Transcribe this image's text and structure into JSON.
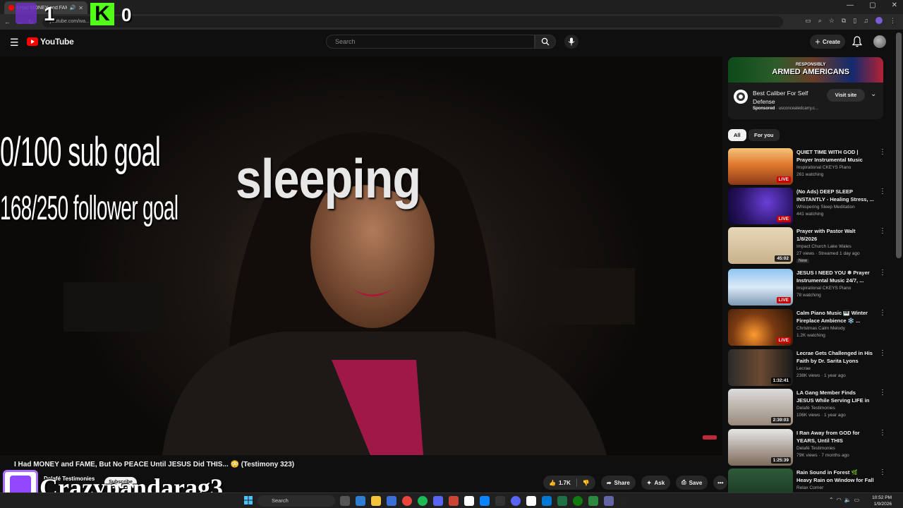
{
  "browser": {
    "tab_title": "I Had MONEY and FAME, B",
    "url": "youtube.com/wa... bey-rbJkto"
  },
  "stream_overlay": {
    "counter_left": "1",
    "counter_right": "0",
    "kick_letter": "K",
    "sub_goal": "0/100 sub goal",
    "follower_goal": "168/250 follower goal",
    "status": "sleeping",
    "streamer_name": "Crazypandarag3"
  },
  "header": {
    "logo_text": "YouTube",
    "search_placeholder": "Search",
    "create_label": "Create"
  },
  "video": {
    "title": "I Had MONEY and FAME, But No PEACE Until JESUS Did THIS... 😳 (Testimony 323)",
    "channel": "Delafé Testimonies",
    "subscribe_label": "Subscribe",
    "likes": "1.7K",
    "share_label": "Share",
    "ask_label": "Ask",
    "save_label": "Save"
  },
  "ad": {
    "banner_text": "ARMED AMERICANS",
    "banner_top": "RESPONSIBLY",
    "title": "Best Caliber For Self Defense",
    "sponsored": "Sponsored",
    "domain": "usconcealedcarry.c...",
    "visit_label": "Visit site"
  },
  "chips": [
    "All",
    "For you"
  ],
  "recommendations": [
    {
      "title": "QUIET TIME WITH GOD | Prayer Instrumental Music 24/7, ...",
      "channel": "Inspirational CKEYS Piano",
      "meta": "261 watching",
      "badge": "LIVE",
      "live": true,
      "thumb": "autumn"
    },
    {
      "title": "(No Ads) DEEP SLEEP INSTANTLY - Healing Stress, ...",
      "channel": "Whispering Sleep Meditation",
      "meta": "441 watching",
      "badge": "LIVE",
      "live": true,
      "thumb": "purple"
    },
    {
      "title": "Prayer with Pastor Walt 1/8/2026",
      "channel": "Impact Church Lake Wales",
      "meta": "27 views · Streamed 1 day ago",
      "badge": "45:02",
      "live": false,
      "new": "New",
      "thumb": "pastor"
    },
    {
      "title": "JESUS I NEED YOU ❄ Prayer Instrumental Music 24/7, ...",
      "channel": "Inspirational CKEYS Piano",
      "meta": "78 watching",
      "badge": "LIVE",
      "live": true,
      "thumb": "winter"
    },
    {
      "title": "Calm Piano Music 🎹 Winter Fireplace Ambience ❄️ ...",
      "channel": "Christmas Calm Melody",
      "meta": "1.2K watching",
      "badge": "LIVE",
      "live": true,
      "thumb": "fireplace"
    },
    {
      "title": "Lecrae Gets Challenged in His Faith by Dr. Sarita Lyons",
      "channel": "Lecrae",
      "meta": "238K views · 1 year ago",
      "badge": "1:32:41",
      "live": false,
      "thumb": "lecrae"
    },
    {
      "title": "LA Gang Member Finds JESUS While Serving LIFE in PRISON....",
      "channel": "Delafé Testimonies",
      "meta": "106K views · 1 year ago",
      "badge": "2:39:03",
      "live": false,
      "thumb": "gang"
    },
    {
      "title": "I Ran Away from GOD for YEARS, Until THIS Happened....",
      "channel": "Delafé Testimonies",
      "meta": "79K views · 7 months ago",
      "badge": "1:25:39",
      "live": false,
      "thumb": "ran"
    },
    {
      "title": "Rain Sound in Forest 🌿 Heavy Rain on Window for Fall Aslee...",
      "channel": "Relax Corner",
      "meta": "",
      "badge": "",
      "live": false,
      "thumb": "rain"
    }
  ],
  "taskbar": {
    "search_label": "Search",
    "time": "10:52 PM",
    "date": "1/9/2026"
  }
}
